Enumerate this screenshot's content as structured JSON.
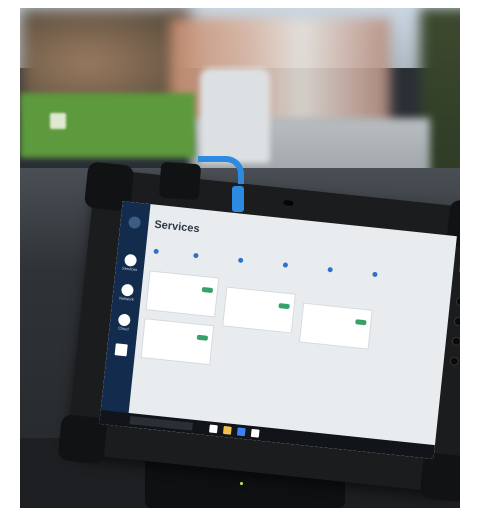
{
  "scene": {
    "description_icons": [
      "obd-adapter-icon",
      "blue-cable-icon",
      "tablet-icon"
    ]
  },
  "screen": {
    "title": "Services",
    "subtitle": "",
    "sidebar": [
      {
        "label": "",
        "icon": "home-icon"
      },
      {
        "label": "Services",
        "icon": "services-icon"
      },
      {
        "label": "Network",
        "icon": "network-icon"
      },
      {
        "label": "Cloud",
        "icon": "cloud-icon"
      },
      {
        "label": "",
        "icon": "chart-icon"
      }
    ],
    "filters": [
      "",
      "",
      "",
      "",
      "",
      ""
    ],
    "cards": [
      {
        "name": "",
        "desc": ""
      },
      {
        "name": "",
        "desc": ""
      },
      {
        "name": "",
        "desc": ""
      },
      {
        "name": "",
        "desc": ""
      }
    ],
    "taskbar": {
      "search_placeholder": ""
    }
  }
}
